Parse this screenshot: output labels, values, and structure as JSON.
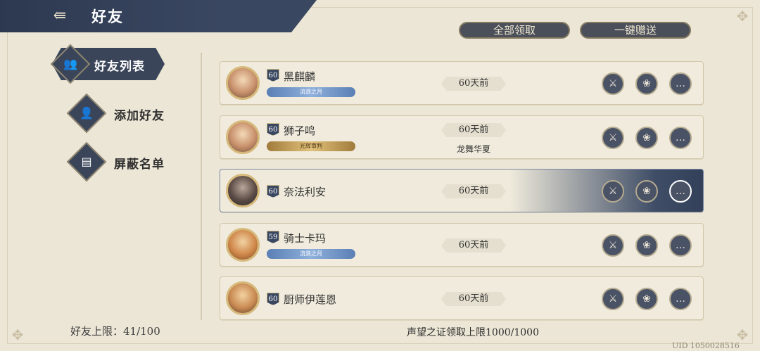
{
  "header": {
    "title": "好友",
    "back_icon": "back-arrow-icon"
  },
  "top_buttons": {
    "claim_all": "全部领取",
    "send_all": "一键赠送"
  },
  "sidebar": {
    "items": [
      {
        "label": "好友列表",
        "icon": "friends-icon",
        "active": true
      },
      {
        "label": "添加好友",
        "icon": "add-friend-icon",
        "active": false
      },
      {
        "label": "屏蔽名单",
        "icon": "blocklist-icon",
        "active": false
      }
    ]
  },
  "friends": [
    {
      "name": "黑麒麟",
      "level": "60",
      "title": "流浪之月",
      "last_online": "60天前",
      "guild": ""
    },
    {
      "name": "狮子鸣",
      "level": "60",
      "title": "光辉审判",
      "last_online": "60天前",
      "guild": "龙舞华夏"
    },
    {
      "name": "奈法利安",
      "level": "60",
      "title": "",
      "last_online": "60天前",
      "guild": ""
    },
    {
      "name": "骑士卡玛",
      "level": "59",
      "title": "流浪之月",
      "last_online": "60天前",
      "guild": ""
    },
    {
      "name": "厨师伊莲恩",
      "level": "60",
      "title": "",
      "last_online": "60天前",
      "guild": ""
    }
  ],
  "footer": {
    "friend_limit": "好友上限：41/100",
    "claim_limit": "声望之证领取上限1000/1000",
    "uid": "UID 1050028516"
  },
  "colors": {
    "header_bg": "#3a4761",
    "paper_bg": "#ece6d6",
    "accent_gold": "#d6b97b"
  }
}
